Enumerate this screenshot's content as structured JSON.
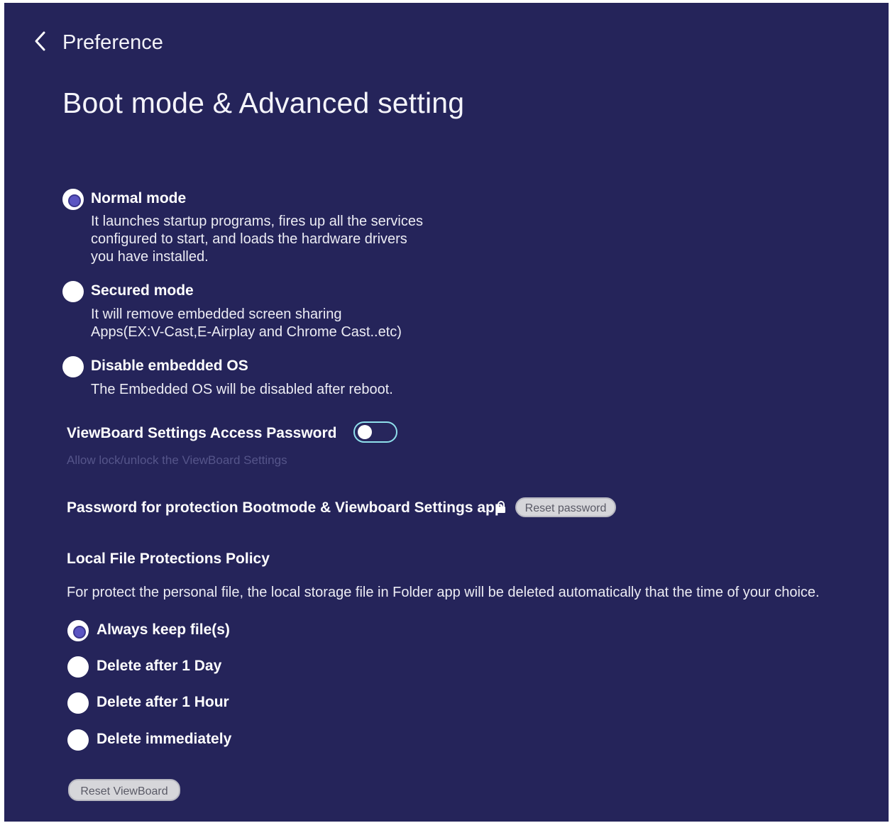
{
  "header": {
    "back_icon": "chevron-left-icon",
    "breadcrumb": "Preference",
    "title": "Boot mode & Advanced setting"
  },
  "boot_modes": [
    {
      "label": "Normal mode",
      "selected": true,
      "desc": [
        "It launches startup programs, fires up all the services",
        "configured to start, and loads the hardware drivers",
        "you have installed."
      ]
    },
    {
      "label": "Secured mode",
      "selected": false,
      "desc": [
        "It will remove embedded screen sharing",
        "Apps(EX:V-Cast,E-Airplay and Chrome Cast..etc)"
      ]
    },
    {
      "label": "Disable embedded OS",
      "selected": false,
      "desc": [
        "The Embedded OS will be disabled after reboot."
      ]
    }
  ],
  "access_password": {
    "label": "ViewBoard Settings Access Password",
    "enabled": false,
    "hint": "Allow lock/unlock the ViewBoard Settings"
  },
  "protection_password": {
    "label": "Password for protection Bootmode & Viewboard Settings app",
    "lock_icon": "lock-icon",
    "reset_label": "Reset password"
  },
  "file_policy": {
    "heading": "Local File Protections Policy",
    "description": "For protect the personal file, the local storage file in Folder app will be deleted automatically that the time of your choice.",
    "options": [
      {
        "label": "Always keep file(s)",
        "selected": true
      },
      {
        "label": "Delete after 1 Day",
        "selected": false
      },
      {
        "label": "Delete after 1 Hour",
        "selected": false
      },
      {
        "label": "Delete immediately",
        "selected": false
      }
    ]
  },
  "reset_viewboard_label": "Reset ViewBoard",
  "colors": {
    "background": "#25245a",
    "radio_selected": "#5b55c2",
    "toggle_border": "#8fe0ec",
    "button_bg": "#d6d6da"
  }
}
